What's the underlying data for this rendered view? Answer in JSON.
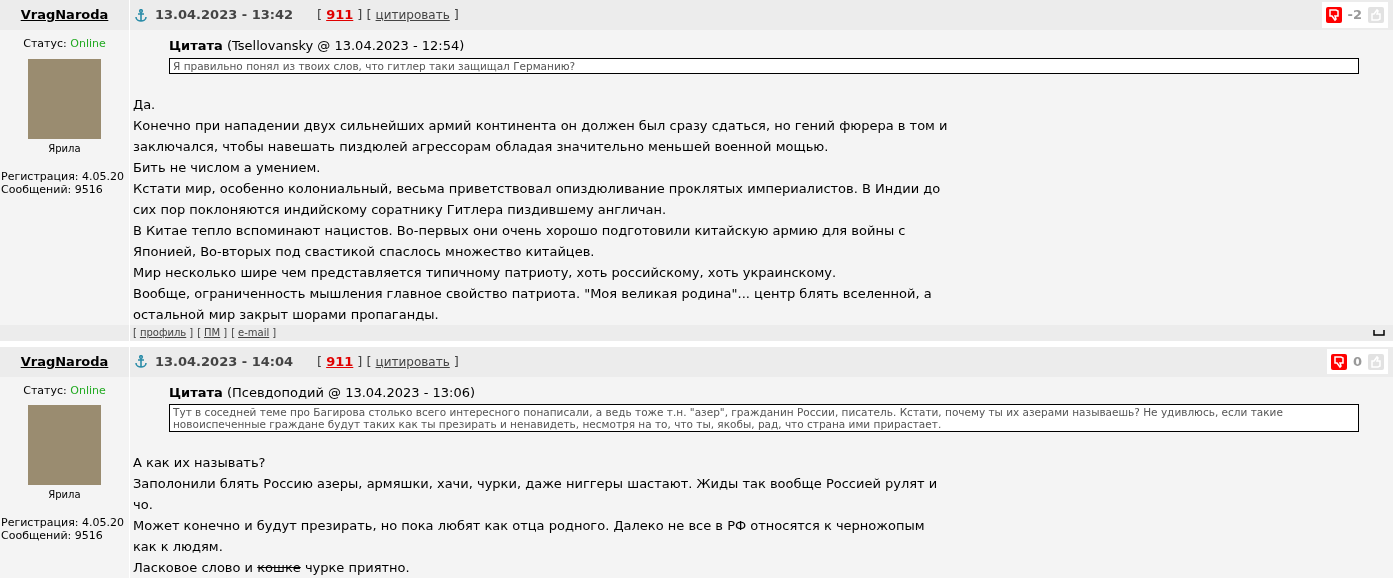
{
  "posts": [
    {
      "author": "VragNaroda",
      "status_label": "Статус:",
      "status": "Online",
      "online": true,
      "rank": "Ярила",
      "registration": "Регистрация: 4.05.20",
      "messages": "Сообщений: 9516",
      "date": "13.04.2023 - 13:42",
      "brackets": [
        "[",
        "] [",
        "]"
      ],
      "post_number": "911",
      "quote_link": "цитировать",
      "rating": "-2",
      "quote": {
        "label": "Цитата",
        "source": "(Tsellovansky @ 13.04.2023 - 12:54)",
        "text": "Я правильно понял из твоих слов, что гитлер таки защищал Германию?"
      },
      "lines": [
        [
          {
            "text": "Да."
          }
        ],
        [
          {
            "text": "Конечно при нападении двух сильнейших армий континента он должен был сразу сдаться, но гений фюрера в том и"
          }
        ],
        [
          {
            "text": "заключался, чтобы навешать пиздюлей агрессорам обладая значительно меньшей военной мощью."
          }
        ],
        [
          {
            "text": "Бить не числом а умением."
          }
        ],
        [
          {
            "text": "Кстати мир, особенно колониальный, весьма приветствовал опиздюливание проклятых империалистов. В Индии до"
          }
        ],
        [
          {
            "text": "сих пор поклоняются индийскому соратнику Гитлера пиздившему англичан."
          }
        ],
        [
          {
            "text": "В Китае тепло вспоминают нацистов. Во-первых они очень хорошо подготовили китайскую армию для войны с"
          }
        ],
        [
          {
            "text": "Японией, Во-вторых под свастикой спаслось множество китайцев."
          }
        ],
        [
          {
            "text": "Мир несколько шире чем представляется типичному патриоту, хоть российскому, хоть украинскому."
          }
        ],
        [
          {
            "text": "Вообще, ограниченность мышления главное свойство патриота. \"Моя великая родина\"... центр блять вселенной, а"
          }
        ],
        [
          {
            "text": "остальной мир закрыт шорами пропаганды."
          }
        ]
      ],
      "footer": [
        {
          "open": "[",
          "label": "профиль",
          "close": "]"
        },
        {
          "open": "[",
          "label": "ПМ",
          "close": "]"
        },
        {
          "open": "[",
          "label": "e-mail",
          "close": "]"
        }
      ]
    },
    {
      "author": "VragNaroda",
      "status_label": "Статус:",
      "status": "Online",
      "online": true,
      "rank": "Ярила",
      "registration": "Регистрация: 4.05.20",
      "messages": "Сообщений: 9516",
      "date": "13.04.2023 - 14:04",
      "brackets": [
        "[",
        "] [",
        "]"
      ],
      "post_number": "911",
      "quote_link": "цитировать",
      "rating": "0",
      "quote": {
        "label": "Цитата",
        "source": "(Псевдоподий @ 13.04.2023 - 13:06)",
        "text": "Тут в соседней теме про Багирова столько всего интересного понаписали, а ведь тоже т.н. \"азер\", гражданин России, писатель. Кстати, почему ты их азерами называешь? Не удивлюсь, если такие новоиспеченные граждане будут таких как ты презирать и ненавидеть, несмотря на то, что ты, якобы, рад, что страна ими прирастает."
      },
      "lines": [
        [
          {
            "text": "А как их называть?"
          }
        ],
        [
          {
            "text": "Заполонили блять Россию азеры, армяшки, хачи, чурки, даже ниггеры шастают. Жиды так вообще Россией рулят и"
          }
        ],
        [
          {
            "text": "чо."
          }
        ],
        [
          {
            "text": "Может конечно и будут презирать, но пока любят как отца родного. Далеко не все в РФ относятся к черножопым"
          }
        ],
        [
          {
            "text": "как к людям."
          }
        ],
        [
          {
            "text": "Ласковое слово и "
          },
          {
            "text": "кошке",
            "struck": true
          },
          {
            "text": " чурке приятно."
          }
        ]
      ]
    }
  ]
}
